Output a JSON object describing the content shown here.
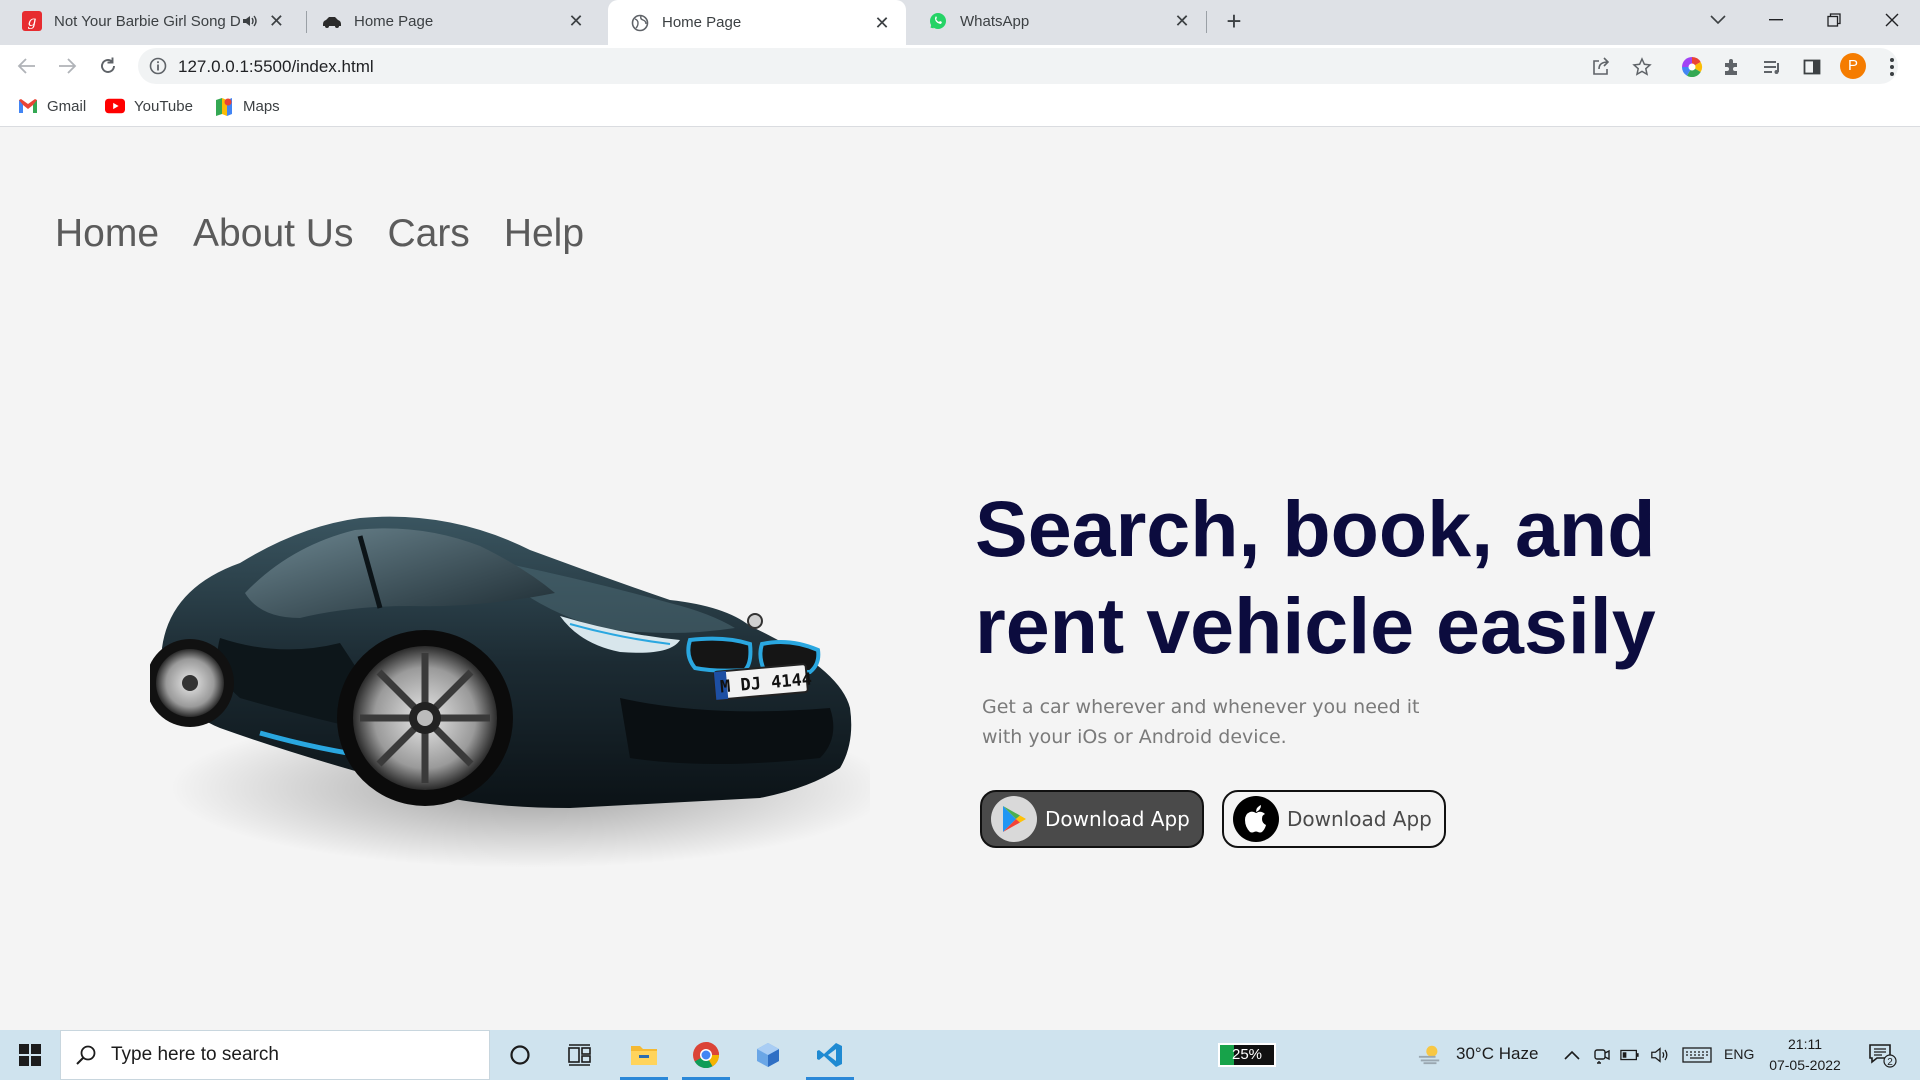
{
  "browser": {
    "tabs": [
      {
        "title": "Not Your Barbie Girl Song Do",
        "icon": "gaana-icon",
        "active": false,
        "muted_icon": true
      },
      {
        "title": "Home Page",
        "icon": "car-favicon-icon",
        "active": false
      },
      {
        "title": "Home Page",
        "icon": "globe-icon",
        "active": true
      },
      {
        "title": "WhatsApp",
        "icon": "whatsapp-icon",
        "active": false
      }
    ],
    "url": "127.0.0.1:5500/index.html",
    "profile_initial": "P",
    "bookmarks": [
      {
        "label": "Gmail",
        "icon": "gmail-icon"
      },
      {
        "label": "YouTube",
        "icon": "youtube-icon"
      },
      {
        "label": "Maps",
        "icon": "maps-icon"
      }
    ]
  },
  "site": {
    "nav": [
      "Home",
      "About Us",
      "Cars",
      "Help"
    ],
    "hero": {
      "title_line1": "Search, book, and",
      "title_line2": "rent vehicle easily",
      "subtitle": "Get a car wherever and whenever you need it with your iOs or Android device."
    },
    "buttons": {
      "android": "Download App",
      "ios": "Download App"
    },
    "car_plate": "M DJ 4144"
  },
  "taskbar": {
    "search_placeholder": "Type here to search",
    "battery_overlay": "25%",
    "battery_level": 0.25,
    "weather": "30°C  Haze",
    "language": "ENG",
    "time": "21:11",
    "date": "07-05-2022",
    "notification_count": "2"
  },
  "colors": {
    "headline": "#0c0c3e",
    "nav_text": "#5b5b5b",
    "page_bg": "#f4f4f4",
    "tabstrip_bg": "#dee1e6",
    "taskbar_bg": "#cfe3ee"
  }
}
